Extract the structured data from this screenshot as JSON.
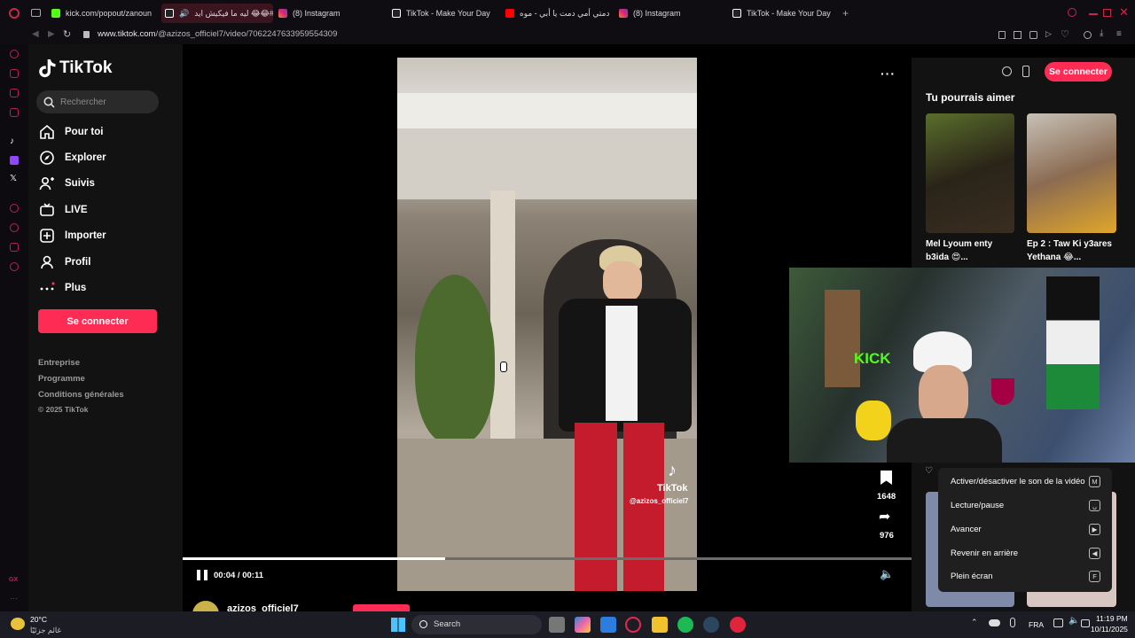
{
  "browser": {
    "tabs": [
      {
        "label": "kick.com/popout/zanoun",
        "active": false
      },
      {
        "label": "ليه ما فيكيش ايد 😂😂#",
        "active": true
      },
      {
        "label": "(8) Instagram",
        "active": false
      },
      {
        "label": "TikTok - Make Your Day",
        "active": false
      },
      {
        "label": "دمتي أمي دمت يا أبي - موه",
        "active": false
      },
      {
        "label": "(8) Instagram",
        "active": false
      },
      {
        "label": "TikTok - Make Your Day",
        "active": false
      }
    ],
    "url_host": "www.tiktok.com",
    "url_path": "/@azizos_officiel7/video/7062247633959554309"
  },
  "sidebar": {
    "brand": "TikTok",
    "search_placeholder": "Rechercher",
    "nav": [
      {
        "label": "Pour toi",
        "icon": "home-icon"
      },
      {
        "label": "Explorer",
        "icon": "compass-icon"
      },
      {
        "label": "Suivis",
        "icon": "following-icon"
      },
      {
        "label": "LIVE",
        "icon": "live-icon"
      },
      {
        "label": "Importer",
        "icon": "upload-icon"
      },
      {
        "label": "Profil",
        "icon": "profile-icon"
      },
      {
        "label": "Plus",
        "icon": "more-icon"
      }
    ],
    "login_label": "Se connecter",
    "footer": [
      "Entreprise",
      "Programme",
      "Conditions générales",
      "© 2025 TikTok"
    ]
  },
  "player": {
    "time": "00:04 / 00:11",
    "progress": 0.36,
    "watermark_brand": "TikTok",
    "watermark_user": "@azizos_officiel7",
    "save_count": "1648",
    "share_count": "976",
    "author": "azizos_officiel7"
  },
  "right": {
    "login_label": "Se connecter",
    "section_title": "Tu pourrais aimer",
    "cards": [
      {
        "caption": "Mel Lyoum enty b3ida 😍..."
      },
      {
        "caption": "Ep 2 : Taw Ki y3ares Yethana 😂..."
      }
    ],
    "webcam_sign": "KICK"
  },
  "shortcut_menu": [
    {
      "label": "Activer/désactiver le son de la vidéo",
      "key": "M"
    },
    {
      "label": "Lecture/pause",
      "key": "␣"
    },
    {
      "label": "Avancer",
      "key": "▶"
    },
    {
      "label": "Revenir en arrière",
      "key": "◀"
    },
    {
      "label": "Plein écran",
      "key": "F"
    }
  ],
  "taskbar": {
    "weather_temp": "20°C",
    "weather_desc": "غائم جزئيًا",
    "search_label": "Search",
    "lang": "FRA",
    "time": "11:19 PM",
    "date": "10/11/2025"
  },
  "opera_badge": "GX",
  "colors": {
    "accent": "#fe2c55",
    "opera_red": "#b8244a"
  }
}
